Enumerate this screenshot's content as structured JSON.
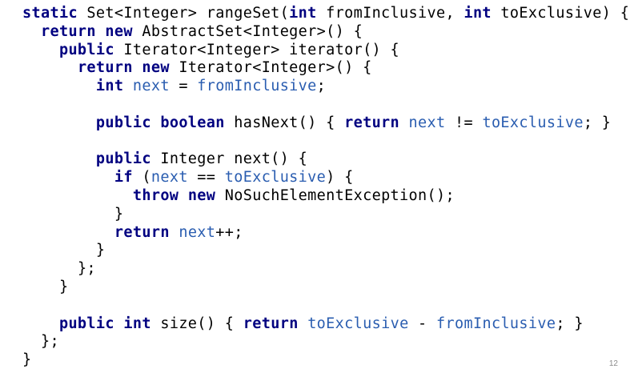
{
  "colors": {
    "keyword": "#000080",
    "field": "#2a5db0",
    "plain": "#000000",
    "background": "#ffffff"
  },
  "code": {
    "lines": [
      {
        "indent": "",
        "tokens": [
          {
            "t": "static",
            "k": "kw"
          },
          {
            "t": " Set<Integer> rangeSet(",
            "k": "pl"
          },
          {
            "t": "int",
            "k": "kw"
          },
          {
            "t": " fromInclusive, ",
            "k": "pl"
          },
          {
            "t": "int",
            "k": "kw"
          },
          {
            "t": " toExclusive) {",
            "k": "pl"
          }
        ]
      },
      {
        "indent": "  ",
        "tokens": [
          {
            "t": "return",
            "k": "kw"
          },
          {
            "t": " ",
            "k": "pl"
          },
          {
            "t": "new",
            "k": "kw"
          },
          {
            "t": " AbstractSet<Integer>() {",
            "k": "pl"
          }
        ]
      },
      {
        "indent": "    ",
        "tokens": [
          {
            "t": "public",
            "k": "kw"
          },
          {
            "t": " Iterator<Integer> iterator() {",
            "k": "pl"
          }
        ]
      },
      {
        "indent": "      ",
        "tokens": [
          {
            "t": "return",
            "k": "kw"
          },
          {
            "t": " ",
            "k": "pl"
          },
          {
            "t": "new",
            "k": "kw"
          },
          {
            "t": " Iterator<Integer>() {",
            "k": "pl"
          }
        ]
      },
      {
        "indent": "        ",
        "tokens": [
          {
            "t": "int",
            "k": "kw"
          },
          {
            "t": " ",
            "k": "pl"
          },
          {
            "t": "next",
            "k": "fld"
          },
          {
            "t": " = ",
            "k": "pl"
          },
          {
            "t": "fromInclusive",
            "k": "fld"
          },
          {
            "t": ";",
            "k": "pl"
          }
        ]
      },
      {
        "indent": "",
        "tokens": []
      },
      {
        "indent": "        ",
        "tokens": [
          {
            "t": "public",
            "k": "kw"
          },
          {
            "t": " ",
            "k": "pl"
          },
          {
            "t": "boolean",
            "k": "kw"
          },
          {
            "t": " hasNext() { ",
            "k": "pl"
          },
          {
            "t": "return",
            "k": "kw"
          },
          {
            "t": " ",
            "k": "pl"
          },
          {
            "t": "next",
            "k": "fld"
          },
          {
            "t": " != ",
            "k": "pl"
          },
          {
            "t": "toExclusive",
            "k": "fld"
          },
          {
            "t": "; }",
            "k": "pl"
          }
        ]
      },
      {
        "indent": "",
        "tokens": []
      },
      {
        "indent": "        ",
        "tokens": [
          {
            "t": "public",
            "k": "kw"
          },
          {
            "t": " Integer next() {",
            "k": "pl"
          }
        ]
      },
      {
        "indent": "          ",
        "tokens": [
          {
            "t": "if",
            "k": "kw"
          },
          {
            "t": " (",
            "k": "pl"
          },
          {
            "t": "next",
            "k": "fld"
          },
          {
            "t": " == ",
            "k": "pl"
          },
          {
            "t": "toExclusive",
            "k": "fld"
          },
          {
            "t": ") {",
            "k": "pl"
          }
        ]
      },
      {
        "indent": "            ",
        "tokens": [
          {
            "t": "throw",
            "k": "kw"
          },
          {
            "t": " ",
            "k": "pl"
          },
          {
            "t": "new",
            "k": "kw"
          },
          {
            "t": " NoSuchElementException();",
            "k": "pl"
          }
        ]
      },
      {
        "indent": "          ",
        "tokens": [
          {
            "t": "}",
            "k": "pl"
          }
        ]
      },
      {
        "indent": "          ",
        "tokens": [
          {
            "t": "return",
            "k": "kw"
          },
          {
            "t": " ",
            "k": "pl"
          },
          {
            "t": "next",
            "k": "fld"
          },
          {
            "t": "++;",
            "k": "pl"
          }
        ]
      },
      {
        "indent": "        ",
        "tokens": [
          {
            "t": "}",
            "k": "pl"
          }
        ]
      },
      {
        "indent": "      ",
        "tokens": [
          {
            "t": "};",
            "k": "pl"
          }
        ]
      },
      {
        "indent": "    ",
        "tokens": [
          {
            "t": "}",
            "k": "pl"
          }
        ]
      },
      {
        "indent": "",
        "tokens": []
      },
      {
        "indent": "    ",
        "tokens": [
          {
            "t": "public",
            "k": "kw"
          },
          {
            "t": " ",
            "k": "pl"
          },
          {
            "t": "int",
            "k": "kw"
          },
          {
            "t": " size() { ",
            "k": "pl"
          },
          {
            "t": "return",
            "k": "kw"
          },
          {
            "t": " ",
            "k": "pl"
          },
          {
            "t": "toExclusive",
            "k": "fld"
          },
          {
            "t": " - ",
            "k": "pl"
          },
          {
            "t": "fromInclusive",
            "k": "fld"
          },
          {
            "t": "; }",
            "k": "pl"
          }
        ]
      },
      {
        "indent": "  ",
        "tokens": [
          {
            "t": "};",
            "k": "pl"
          }
        ]
      },
      {
        "indent": "",
        "tokens": [
          {
            "t": "}",
            "k": "pl"
          }
        ]
      }
    ]
  },
  "page_number": "12"
}
